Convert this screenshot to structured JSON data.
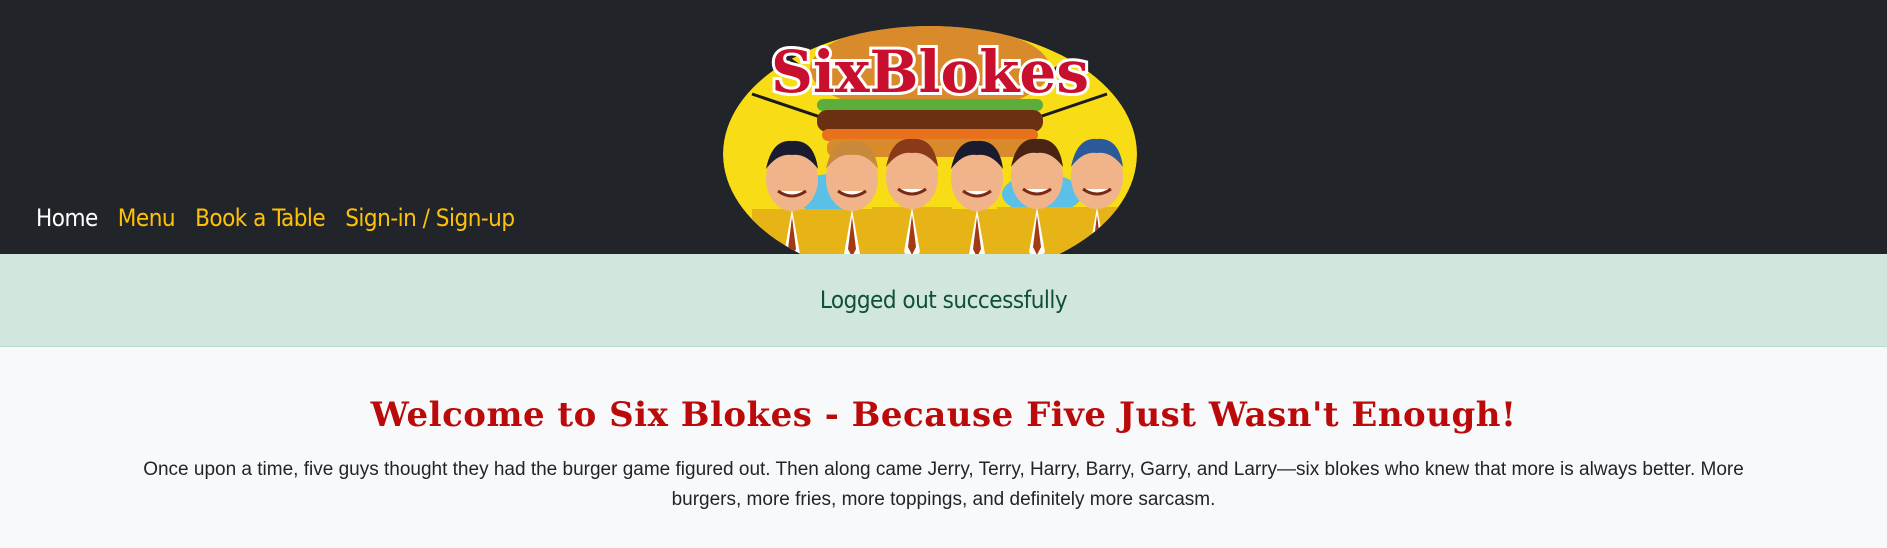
{
  "nav": {
    "items": [
      {
        "label": "Home",
        "active": true
      },
      {
        "label": "Menu",
        "active": false
      },
      {
        "label": "Book a Table",
        "active": false
      },
      {
        "label": "Sign-in / Sign-up",
        "active": false
      }
    ]
  },
  "logo": {
    "text": "SixBlokes",
    "icon": "burger-logo-icon"
  },
  "alert": {
    "message": "Logged out successfully"
  },
  "main": {
    "title": "Welcome to Six Blokes - Because Five Just Wasn't Enough!",
    "intro": "Once upon a time, five guys thought they had the burger game figured out. Then along came Jerry, Terry, Harry, Barry, Garry, and Larry—six blokes who knew that more is always better. More burgers, more fries, more toppings, and definitely more sarcasm."
  },
  "colors": {
    "navbar_bg": "#212529",
    "nav_link": "#ffc107",
    "nav_active": "#ffffff",
    "alert_bg": "#d1e7dd",
    "alert_text": "#0f5132",
    "title": "#bb0a0a",
    "logo_yellow": "#f7dc16"
  }
}
